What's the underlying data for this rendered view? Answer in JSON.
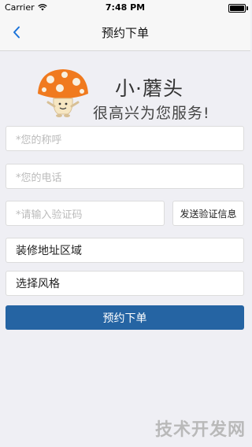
{
  "status_bar": {
    "carrier": "Carrier",
    "time": "7:48 PM"
  },
  "nav": {
    "title": "预约下单"
  },
  "hero": {
    "name": "小·蘑头",
    "tagline": "很高兴为您服务!"
  },
  "form": {
    "name_placeholder": "*您的称呼",
    "phone_placeholder": "*您的电话",
    "code_placeholder": "*请输入验证码",
    "send_code_label": "发送验证信息",
    "area_label": "装修地址区域",
    "style_label": "选择风格",
    "submit_label": "预约下单"
  },
  "watermark": "技术开发网",
  "colors": {
    "accent": "#2564a3",
    "background": "#efeff4"
  }
}
